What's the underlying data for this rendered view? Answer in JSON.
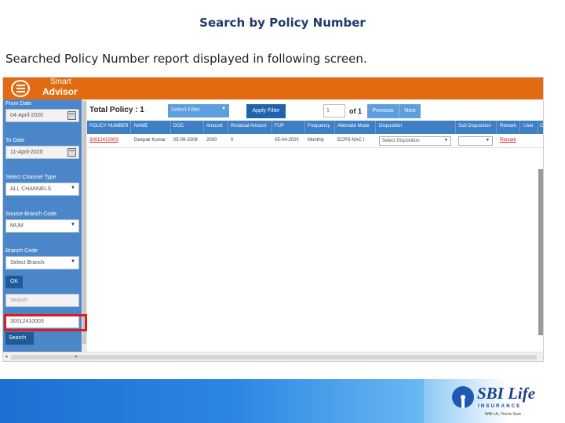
{
  "slide": {
    "title": "Search by Policy Number",
    "description": "Searched Policy Number report displayed in following screen."
  },
  "app": {
    "brand_top": "Smart",
    "brand_main": "Advisor",
    "sidebar": {
      "from_date_label": "From Date",
      "from_date_value": "04-April-2020",
      "to_date_label": "To Date",
      "to_date_value": "11-April-2020",
      "channel_label": "Select Channel Type",
      "channel_value": "ALL CHANNELS",
      "source_branch_label": "Source Branch Code",
      "source_branch_value": "MUM",
      "branch_label": "Branch Code",
      "branch_placeholder": "Select Branch",
      "ok_label": "OK",
      "search_placeholder": "Search",
      "policy_input_value": "30012410003",
      "search_button": "Search"
    },
    "toolbar": {
      "total_label": "Total Policy : 1",
      "filter_placeholder": "Select Filter",
      "apply_label": "Apply Filter",
      "page_value": "1",
      "page_of": "of 1",
      "previous_label": "Previous",
      "next_label": "Next"
    },
    "table": {
      "headers": [
        "POLICY NUMBER",
        "NAME",
        "DOC",
        "Amount",
        "Residual Amount",
        "FUP",
        "Frequency",
        "Alternate Mode",
        "Disposition",
        "Sub Disposition",
        "Remark",
        "User",
        "Ca"
      ],
      "rows": [
        {
          "policy_number": "30012410003",
          "name": "Deepak Kumar",
          "doc": "05-09-2008",
          "amount": "2000",
          "residual_amount": "0",
          "fup": "05-04-2020",
          "frequency": "Monthly",
          "alternate_mode": "ECPS-NAC I",
          "disposition": "Select Disposition",
          "sub_disposition": "",
          "remark": "Remark"
        }
      ]
    }
  },
  "footer": {
    "logo_name": "SBI Life",
    "logo_sub": "INSURANCE",
    "logo_tag": "With Us, You're Sure"
  },
  "colors": {
    "topbar": "#e26b12",
    "sidebar": "#4b87c8",
    "table_header": "#3f7fc4",
    "highlight": "#e11b1b",
    "title": "#1f3a6e"
  }
}
